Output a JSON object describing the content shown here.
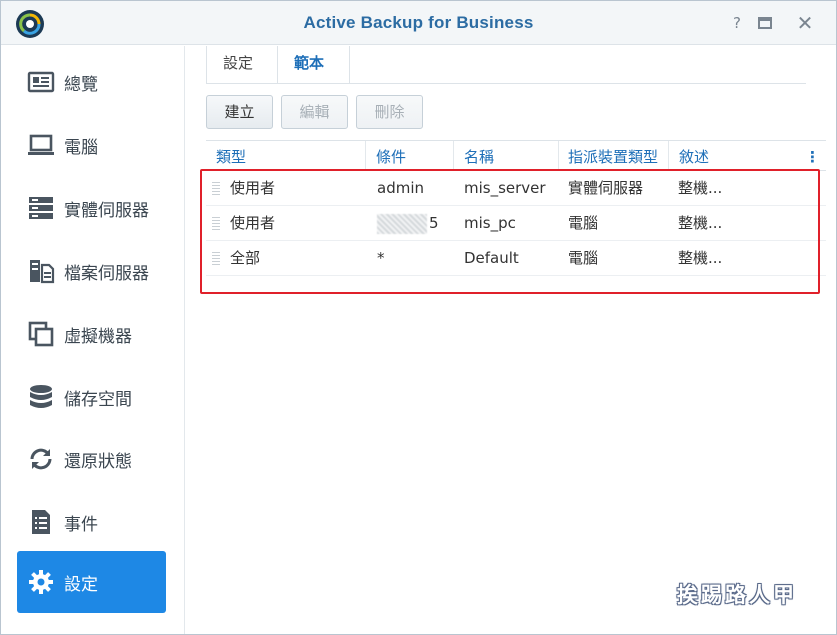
{
  "window": {
    "title": "Active Backup for Business"
  },
  "sidebar": {
    "items": [
      {
        "label": "總覽",
        "icon": "overview-icon"
      },
      {
        "label": "電腦",
        "icon": "laptop-icon"
      },
      {
        "label": "實體伺服器",
        "icon": "server-icon"
      },
      {
        "label": "檔案伺服器",
        "icon": "file-server-icon"
      },
      {
        "label": "虛擬機器",
        "icon": "virtual-machine-icon"
      },
      {
        "label": "儲存空間",
        "icon": "storage-icon"
      },
      {
        "label": "還原狀態",
        "icon": "restore-icon"
      },
      {
        "label": "事件",
        "icon": "event-list-icon"
      },
      {
        "label": "設定",
        "icon": "gear-icon",
        "active": true
      }
    ]
  },
  "tabs": {
    "settings": "設定",
    "templates": "範本"
  },
  "toolbar": {
    "create": "建立",
    "edit": "編輯",
    "delete": "刪除"
  },
  "table": {
    "headers": {
      "type": "類型",
      "condition": "條件",
      "name": "名稱",
      "device_type": "指派裝置類型",
      "description": "敘述"
    },
    "rows": [
      {
        "type": "使用者",
        "condition": "admin",
        "name": "mis_server",
        "device_type": "實體伺服器",
        "description": "整機..."
      },
      {
        "type": "使用者",
        "condition": "5",
        "name": "mis_pc",
        "device_type": "電腦",
        "description": "整機..."
      },
      {
        "type": "全部",
        "condition": "*",
        "name": "Default",
        "device_type": "電腦",
        "description": "整機..."
      }
    ]
  },
  "watermark": "挨踢路人甲",
  "colors": {
    "accent": "#1e88e5",
    "title": "#2c6ca3",
    "highlight": "#e0202a"
  }
}
